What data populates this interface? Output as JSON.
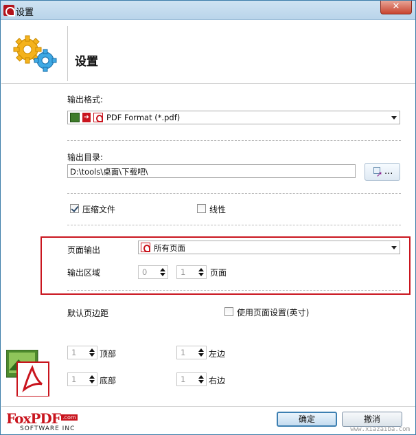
{
  "window": {
    "title": "设置",
    "close_glyph": "✕"
  },
  "header": {
    "title": "设置",
    "icon": "gears-icon"
  },
  "output_format": {
    "label": "输出格式:",
    "value": "PDF Format (*.pdf)"
  },
  "output_dir": {
    "label": "输出目录:",
    "value": "D:\\tools\\桌面\\下载吧\\",
    "browse_label": "..."
  },
  "options": {
    "compress_label": "压缩文件",
    "compress_checked": true,
    "linear_label": "线性",
    "linear_checked": false
  },
  "page_output": {
    "label": "页面输出",
    "value": "所有页面",
    "range_label": "输出区域",
    "range_from": "0",
    "range_to": "1",
    "range_unit": "页面"
  },
  "margins": {
    "label": "默认页边距",
    "use_page_setting_label": "使用页面设置(英寸)",
    "use_page_setting_checked": false,
    "top_value": "1",
    "top_label": "顶部",
    "left_value": "1",
    "left_label": "左边",
    "bottom_value": "1",
    "bottom_label": "底部",
    "right_value": "1",
    "right_label": "右边"
  },
  "footer": {
    "ok_label": "确定",
    "cancel_label": "撤消",
    "brand_text": "FoxPDF",
    "brand_com": ".com",
    "brand_sub": "SOFTWARE INC",
    "watermark": "www.xiazaiba.com"
  },
  "colors": {
    "accent": "#3c7fb1",
    "highlight": "#c9151e"
  }
}
